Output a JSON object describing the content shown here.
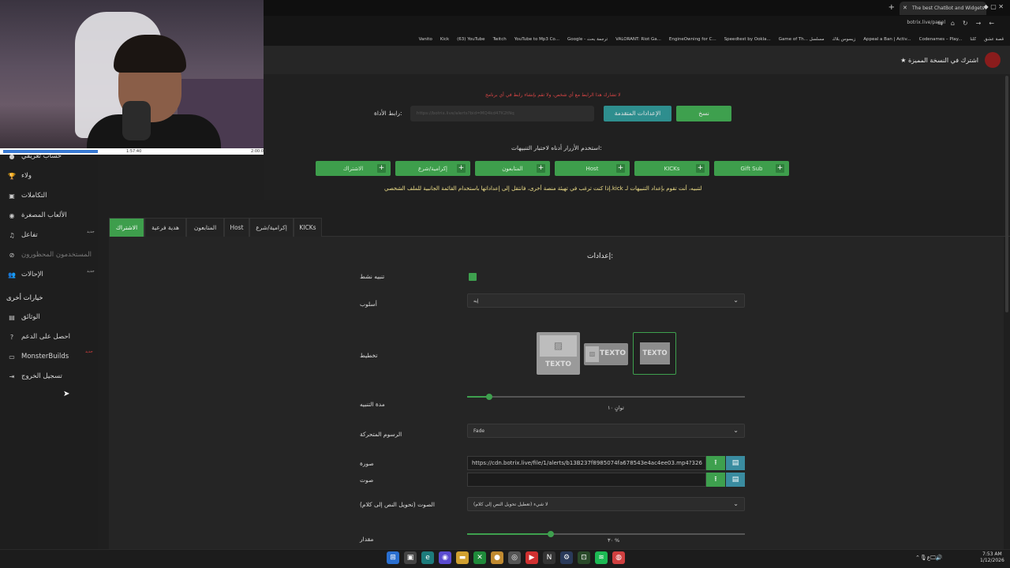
{
  "browser": {
    "tab_title": "The best ChatBot and Widgets",
    "url": "botrix.live/panel",
    "bookmarks": [
      "قصة عشق",
      "كلنا",
      "Codenames – Play...",
      "Appeal a Ban | Activ...",
      "زيسوس بلاك",
      "Game of Th... مسلسل",
      "Speedtest by Ookla...",
      "EngineOwning for C...",
      "VALORANT: Riot Ga...",
      "Google - ترجمة بحث",
      "YouTube to Mp3 Co...",
      "Twitch",
      "(63) YouTube",
      "Kick",
      "Vanito"
    ]
  },
  "header": {
    "premium_label": "اشترك في النسخة المميزة"
  },
  "webcam": {
    "time_current": "1:57:40",
    "time_total": "2:00:00"
  },
  "sidebar": {
    "items": [
      {
        "label": "حساب تعريفي",
        "icon": "user-icon"
      },
      {
        "label": "ولاء",
        "icon": "trophy-icon"
      },
      {
        "label": "التكاملات",
        "icon": "puzzle-icon"
      },
      {
        "label": "الألعاب المصغرة",
        "icon": "gamepad-icon"
      },
      {
        "label": "تفاعل",
        "icon": "music-icon",
        "badge": "جديد"
      },
      {
        "label": "المستخدمون المحظورون",
        "icon": "ban-icon"
      },
      {
        "label": "الإحالات",
        "icon": "users-icon",
        "badge": "جديد"
      }
    ],
    "other_heading": "خيارات أخرى",
    "other_items": [
      {
        "label": "الوثائق",
        "icon": "docs-icon"
      },
      {
        "label": "احصل على الدعم",
        "icon": "help-icon"
      },
      {
        "label": "MonsterBuilds",
        "icon": "monitor-icon",
        "badge": "جديد"
      },
      {
        "label": "تسجيل الخروج",
        "icon": "logout-icon"
      }
    ]
  },
  "overlay": {
    "warning": "لا تشارك هذا الرابط مع أي شخص، ولا تقم بإنشاء رابط في أي برنامج",
    "link_label": "رابط الأداة:",
    "link_value": "https://botrix.live/alerts?bid=MQ4kd47K2tNq",
    "advanced_button": "الإعدادات المتقدمة",
    "copy_button": "نسخ",
    "test_hint": "استخدم الأزرار أدناه لاختبار التنبيهات:",
    "test_buttons": [
      "Gift Sub",
      "KICKs",
      "Host",
      "المتابعون",
      "إكرامية/شرع",
      "الاشتراك"
    ],
    "other_platform_note": "إذا كنت ترغب في تهيئة منصة أخرى، فانتقل إلى إعداداتها باستخدام القائمة الجانبية للملف الشخصي.kick لتنبيه، أنت تقوم بإعداد التنبيهات لـ"
  },
  "alert_tabs": [
    "الاشتراك",
    "هدية فرعية",
    "المتابعون",
    "Host",
    "إكرامية/شرع",
    "KICKs"
  ],
  "settings": {
    "title": "إعدادات:",
    "active_label": "تنبيه نشط",
    "style_label": "أسلوب",
    "style_value": "إيه",
    "layout_label": "تخطيط",
    "layout_text": "TEXTO",
    "duration_label": "مدة التنبيه",
    "duration_value": "ثوانٍ ١٠",
    "duration_fraction": 0.08,
    "animation_label": "الرسوم المتحركة",
    "animation_value": "Fade",
    "image_label": "صورة",
    "image_value": "https://cdn.botrix.live/file/1/alerts/b13B237f8985074fa678543e4ac4ee03.mp4?326",
    "sound_label": "صوت",
    "sound_value": "",
    "tts_label": "الصوت (تحويل النص إلى كلام)",
    "tts_value": "لا شيء (تعطيل تحويل النص إلى كلام)",
    "volume_label": "مقدار",
    "volume_value": "٣٠ %",
    "volume_fraction": 0.3
  },
  "taskbar": {
    "time": "7:53 AM",
    "date": "1/12/2026"
  },
  "colors": {
    "accent": "#3ea04e",
    "teal": "#2e8e8e",
    "warning": "#d94545",
    "note": "#f0e08a"
  }
}
